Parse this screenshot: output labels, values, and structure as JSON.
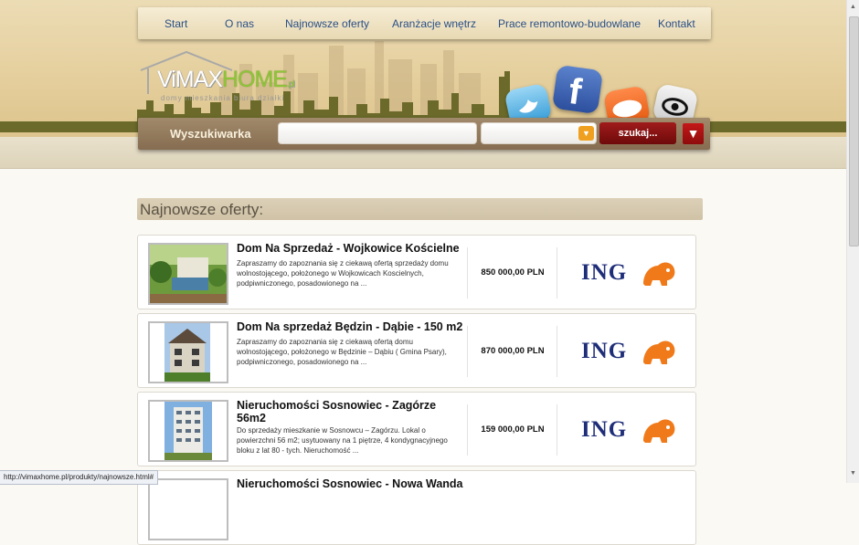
{
  "nav": {
    "items": [
      "Start",
      "O nas",
      "Najnowsze oferty",
      "Aranżacje wnętrz",
      "Prace remontowo-budowlane",
      "Kontakt"
    ]
  },
  "logo": {
    "text_vimax": "ViMAX",
    "text_home": "HOME",
    "tld": ".pl",
    "tagline": "domy mieszkania biura działki"
  },
  "search": {
    "label": "Wyszukiwarka",
    "input_value": "",
    "select_value": "",
    "button_label": "szukaj...",
    "down_symbol": "▼",
    "select_symbol": "▼"
  },
  "section": {
    "title": "Najnowsze oferty:"
  },
  "listings": [
    {
      "title": "Dom Na Sprzedaż - Wojkowice Kościelne",
      "desc": "Zapraszamy do zapoznania się z ciekawą ofertą sprzedaży domu wolnostojącego, położonego w Wojkowicach Koscielnych, podpiwniczonego, posadowionego na ...",
      "price": "850 000,00 PLN",
      "bank": "ING"
    },
    {
      "title": "Dom Na sprzedaż Będzin - Dąbie - 150 m2",
      "desc": "Zapraszamy do zapoznania się z ciekawą ofertą domu wolnostojącego, położonego w Będzinie – Dąbiu ( Gmina Psary), podpiwniczonego, posadowionego na ...",
      "price": "870 000,00 PLN",
      "bank": "ING"
    },
    {
      "title": "Nieruchomości Sosnowiec - Zagórze 56m2",
      "desc": "Do sprzedaży mieszkanie w Sosnowcu – Zagórzu. Lokal o powierzchni 56 m2; usytuowany na 1 piętrze, 4 kondygnacyjnego bloku z lat 80 - tych. Nieruchomość ...",
      "price": "159 000,00 PLN",
      "bank": "ING"
    },
    {
      "title": "Nieruchomości Sosnowiec - Nowa Wanda"
    }
  ],
  "statusbar": {
    "url": "http://vimaxhome.pl/produkty/najnowsze.html#"
  },
  "colors": {
    "nav_link": "#2a4f86",
    "logo_green": "#8fc43a",
    "search_btn": "#a01b1b",
    "ing_blue": "#1f2e78",
    "ing_orange": "#f07a1a"
  }
}
